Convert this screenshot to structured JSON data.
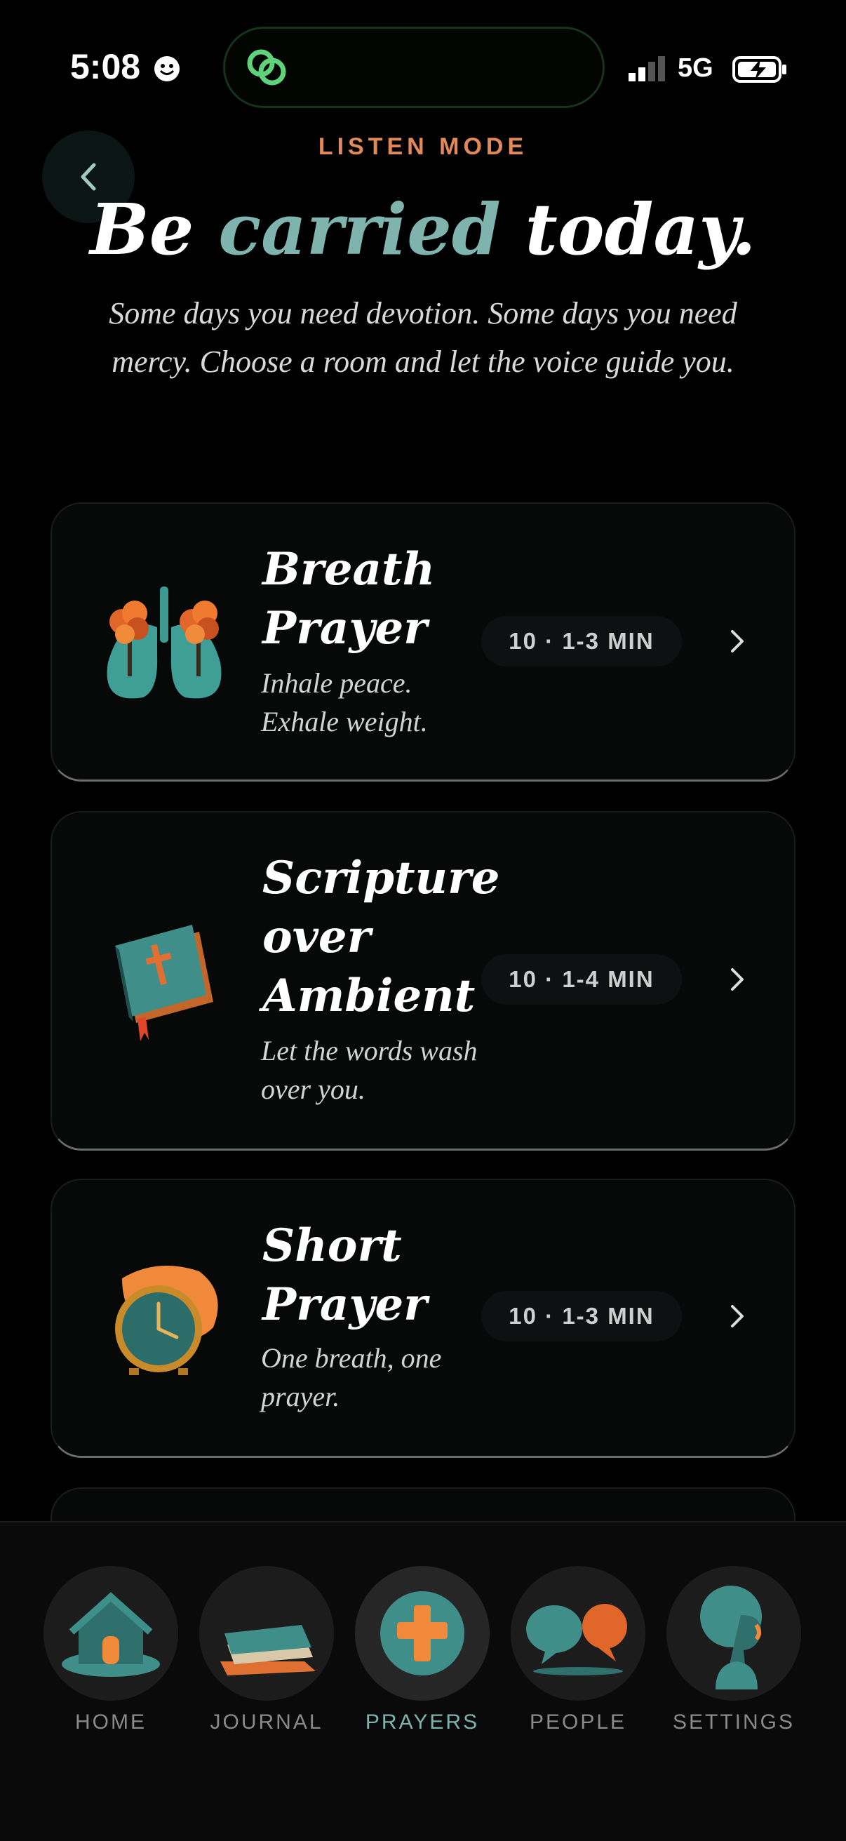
{
  "status_bar": {
    "time": "5:08",
    "network": "5G"
  },
  "header": {
    "eyebrow": "LISTEN MODE",
    "title_part1": "Be",
    "title_accent": "carried",
    "title_part2": "today.",
    "subtitle": "Some days you need devotion. Some days you need mercy. Choose a room and let the voice guide you."
  },
  "cards": [
    {
      "title": "Breath Prayer",
      "description": "Inhale peace. Exhale weight.",
      "badge": "10 · 1-3 MIN",
      "icon": "lungs-tree-icon"
    },
    {
      "title": "Scripture over Ambient",
      "description": "Let the words wash over you.",
      "badge": "10 · 1-4 MIN",
      "icon": "bible-icon"
    },
    {
      "title": "Short Prayer",
      "description": "One breath, one prayer.",
      "badge": "10 · 1-3 MIN",
      "icon": "clock-icon"
    }
  ],
  "nav": {
    "items": [
      {
        "label": "HOME",
        "icon": "house-icon"
      },
      {
        "label": "JOURNAL",
        "icon": "book-icon"
      },
      {
        "label": "PRAYERS",
        "icon": "cross-icon",
        "active": true
      },
      {
        "label": "PEOPLE",
        "icon": "speech-bubbles-icon"
      },
      {
        "label": "SETTINGS",
        "icon": "head-profile-icon"
      }
    ]
  },
  "colors": {
    "accent_teal": "#7fb3ad",
    "accent_orange": "#e08a5c",
    "background": "#000000"
  }
}
